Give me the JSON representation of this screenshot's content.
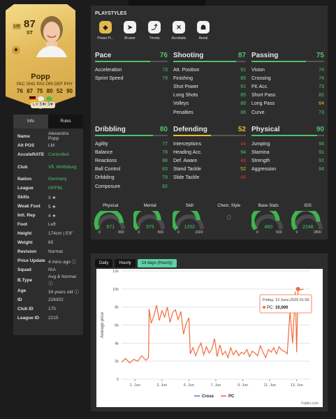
{
  "card": {
    "rating": "87",
    "position": "ST",
    "alt_position_badge": "LM",
    "name": "Popp",
    "stat_labels": [
      "PAC",
      "SHO",
      "PAS",
      "DRI",
      "DEF",
      "PHY"
    ],
    "stat_values": [
      "76",
      "87",
      "75",
      "80",
      "52",
      "90"
    ],
    "chem_line": "L⯑ 5★/ 3★"
  },
  "info": {
    "tabs": [
      "Info",
      "Rules"
    ],
    "rows": [
      {
        "k": "Name",
        "v": "Alexandra Popp"
      },
      {
        "k": "Alt POS",
        "v": "LM"
      },
      {
        "k": "AcceleRATE",
        "v": "Controlled"
      },
      {
        "k": "Club",
        "v": "VfL Wolfsburg"
      },
      {
        "k": "Nation",
        "v": "Germany"
      },
      {
        "k": "League",
        "v": "GPFBL"
      },
      {
        "k": "Skills",
        "v": "3 ★"
      },
      {
        "k": "Weak Foot",
        "v": "5 ★"
      },
      {
        "k": "Intl. Rep",
        "v": "4 ★"
      },
      {
        "k": "Foot",
        "v": "Left"
      },
      {
        "k": "Height",
        "v": "174cm | 5'9\""
      },
      {
        "k": "Weight",
        "v": "65"
      },
      {
        "k": "Revision",
        "v": "Normal"
      },
      {
        "k": "Price Update",
        "v": "4 mins ago ⓘ"
      },
      {
        "k": "Squad",
        "v": "N\\A"
      },
      {
        "k": "B.Type",
        "v": "Avg & Normal ⓘ"
      },
      {
        "k": "Age",
        "v": "34 years old ⓘ"
      },
      {
        "k": "ID",
        "v": "226302"
      },
      {
        "k": "Club ID",
        "v": "175"
      },
      {
        "k": "League ID",
        "v": "2215"
      }
    ]
  },
  "playstyles": {
    "title": "PLAYSTYLES",
    "items": [
      {
        "label": "Power H...",
        "icon": "power-header-icon",
        "glyph": "◆"
      },
      {
        "label": "Bruiser",
        "icon": "bruiser-icon",
        "glyph": "➤"
      },
      {
        "label": "Trivela",
        "icon": "trivela-icon",
        "glyph": "⤴"
      },
      {
        "label": "Acrobatic",
        "icon": "acrobatic-icon",
        "glyph": "✕"
      },
      {
        "label": "Aerial",
        "icon": "aerial-icon",
        "glyph": "☗"
      }
    ]
  },
  "categories": [
    {
      "name": "Pace",
      "value": "76",
      "color": "#4fc36b",
      "subs": [
        [
          "Acceleration",
          "73"
        ],
        [
          "Sprint Speed",
          "79"
        ]
      ]
    },
    {
      "name": "Shooting",
      "value": "87",
      "color": "#4fc36b",
      "subs": [
        [
          "Att. Position",
          "91"
        ],
        [
          "Finishing",
          "86"
        ],
        [
          "Shot Power",
          "91"
        ],
        [
          "Long Shots",
          "85"
        ],
        [
          "Volleys",
          "88"
        ],
        [
          "Penalties",
          "86"
        ]
      ]
    },
    {
      "name": "Passing",
      "value": "75",
      "color": "#4fc36b",
      "subs": [
        [
          "Vision",
          "74"
        ],
        [
          "Crossing",
          "74"
        ],
        [
          "FK Acc.",
          "73"
        ],
        [
          "Short Pass",
          "82"
        ],
        [
          "Long Pass",
          "64"
        ],
        [
          "Curve",
          "73"
        ]
      ]
    },
    {
      "name": "Dribbling",
      "value": "80",
      "color": "#4fc36b",
      "subs": [
        [
          "Agility",
          "77"
        ],
        [
          "Balance",
          "78"
        ],
        [
          "Reactions",
          "88"
        ],
        [
          "Ball Control",
          "83"
        ],
        [
          "Dribbling",
          "78"
        ],
        [
          "Composure",
          "82"
        ]
      ]
    },
    {
      "name": "Defending",
      "value": "52",
      "color": "#e6c12b",
      "subs": [
        [
          "Interceptions",
          "44"
        ],
        [
          "Heading Acc.",
          "94"
        ],
        [
          "Def. Aware",
          "48"
        ],
        [
          "Stand Tackle",
          "52"
        ],
        [
          "Slide Tackle",
          "48"
        ]
      ]
    },
    {
      "name": "Physical",
      "value": "90",
      "color": "#4fc36b",
      "subs": [
        [
          "Jumping",
          "94"
        ],
        [
          "Stamina",
          "91"
        ],
        [
          "Strength",
          "91"
        ],
        [
          "Aggression",
          "84"
        ]
      ]
    }
  ],
  "gauges": [
    {
      "label": "Physical",
      "value": "671",
      "min": "0",
      "max": "800",
      "fraction": 0.84
    },
    {
      "label": "Mental",
      "value": "375",
      "min": "0",
      "max": "500",
      "fraction": 0.75
    },
    {
      "label": "Skill",
      "value": "1202",
      "min": "0",
      "max": "1600",
      "fraction": 0.75
    },
    {
      "label": "Chem. Style",
      "value": "0",
      "min": "",
      "max": "",
      "fraction": 0
    },
    {
      "label": "Base Stats",
      "value": "460",
      "min": "0",
      "max": "600",
      "fraction": 0.77
    },
    {
      "label": "IGS",
      "value": "2248",
      "min": "0",
      "max": "2800",
      "fraction": 0.8
    }
  ],
  "price": {
    "tabs": [
      "Daily",
      "Hourly",
      "14 days (Hourly)"
    ],
    "active_tab": "14 days (Hourly)",
    "tooltip": {
      "date": "Friday, 13 June,2025 01:00",
      "label": "PC:",
      "value": "10,000"
    },
    "watermark": "Futbin.com",
    "accent": "#f26b3a"
  },
  "chart_data": {
    "type": "line",
    "title": "",
    "xlabel": "",
    "ylabel": "Average price",
    "ylim": [
      0,
      12000
    ],
    "yticks": [
      "0",
      "2k",
      "4k",
      "6k",
      "8k",
      "10k",
      "12k"
    ],
    "xticks": [
      "1. Jun",
      "3. Jun",
      "5. Jun",
      "7. Jun",
      "9. Jun",
      "11. Jun",
      "13. Jun"
    ],
    "xrange_days": [
      31,
      45
    ],
    "legend": [
      "Cross",
      "PC"
    ],
    "series": [
      {
        "name": "Cross",
        "color": "#4a7fd4",
        "x": [],
        "values": []
      },
      {
        "name": "PC",
        "color": "#f26b3a",
        "x": [
          31.0,
          31.3,
          31.6,
          31.9,
          32.2,
          32.5,
          32.8,
          33.0,
          33.05,
          33.2,
          33.4,
          33.6,
          33.8,
          34.0,
          34.2,
          34.4,
          34.6,
          34.8,
          35.0,
          35.2,
          35.4,
          35.6,
          35.8,
          36.0,
          36.1,
          36.3,
          36.5,
          36.7,
          36.9,
          37.1,
          37.3,
          37.5,
          37.7,
          37.9,
          38.1,
          38.3,
          38.5,
          38.7,
          38.9,
          39.1,
          39.3,
          39.5,
          39.7,
          39.9,
          40.1,
          40.3,
          40.5,
          40.7,
          40.9,
          41.1,
          41.3,
          41.5,
          41.7,
          41.9,
          42.1,
          42.3,
          42.5,
          42.7,
          42.9,
          43.1,
          43.3,
          43.5,
          43.7,
          43.9,
          44.0,
          44.1,
          44.2,
          44.3,
          44.5
        ],
        "values": [
          1900,
          2300,
          1800,
          2200,
          2000,
          2600,
          2100,
          2400,
          7800,
          6200,
          7000,
          8200,
          6500,
          7600,
          6900,
          8000,
          6300,
          7400,
          7700,
          6600,
          7500,
          5000,
          6200,
          6800,
          2800,
          3500,
          2600,
          3400,
          4000,
          2700,
          3600,
          2900,
          3300,
          4500,
          2500,
          3800,
          2700,
          3100,
          2400,
          3500,
          2700,
          3200,
          2600,
          3000,
          2800,
          3300,
          2500,
          3100,
          2900,
          2600,
          3700,
          3000,
          2400,
          3300,
          3000,
          3500,
          2800,
          3600,
          3200,
          3100,
          2800,
          7500,
          4000,
          9700,
          3000,
          10000,
          10000,
          9900,
          10000
        ]
      }
    ]
  }
}
